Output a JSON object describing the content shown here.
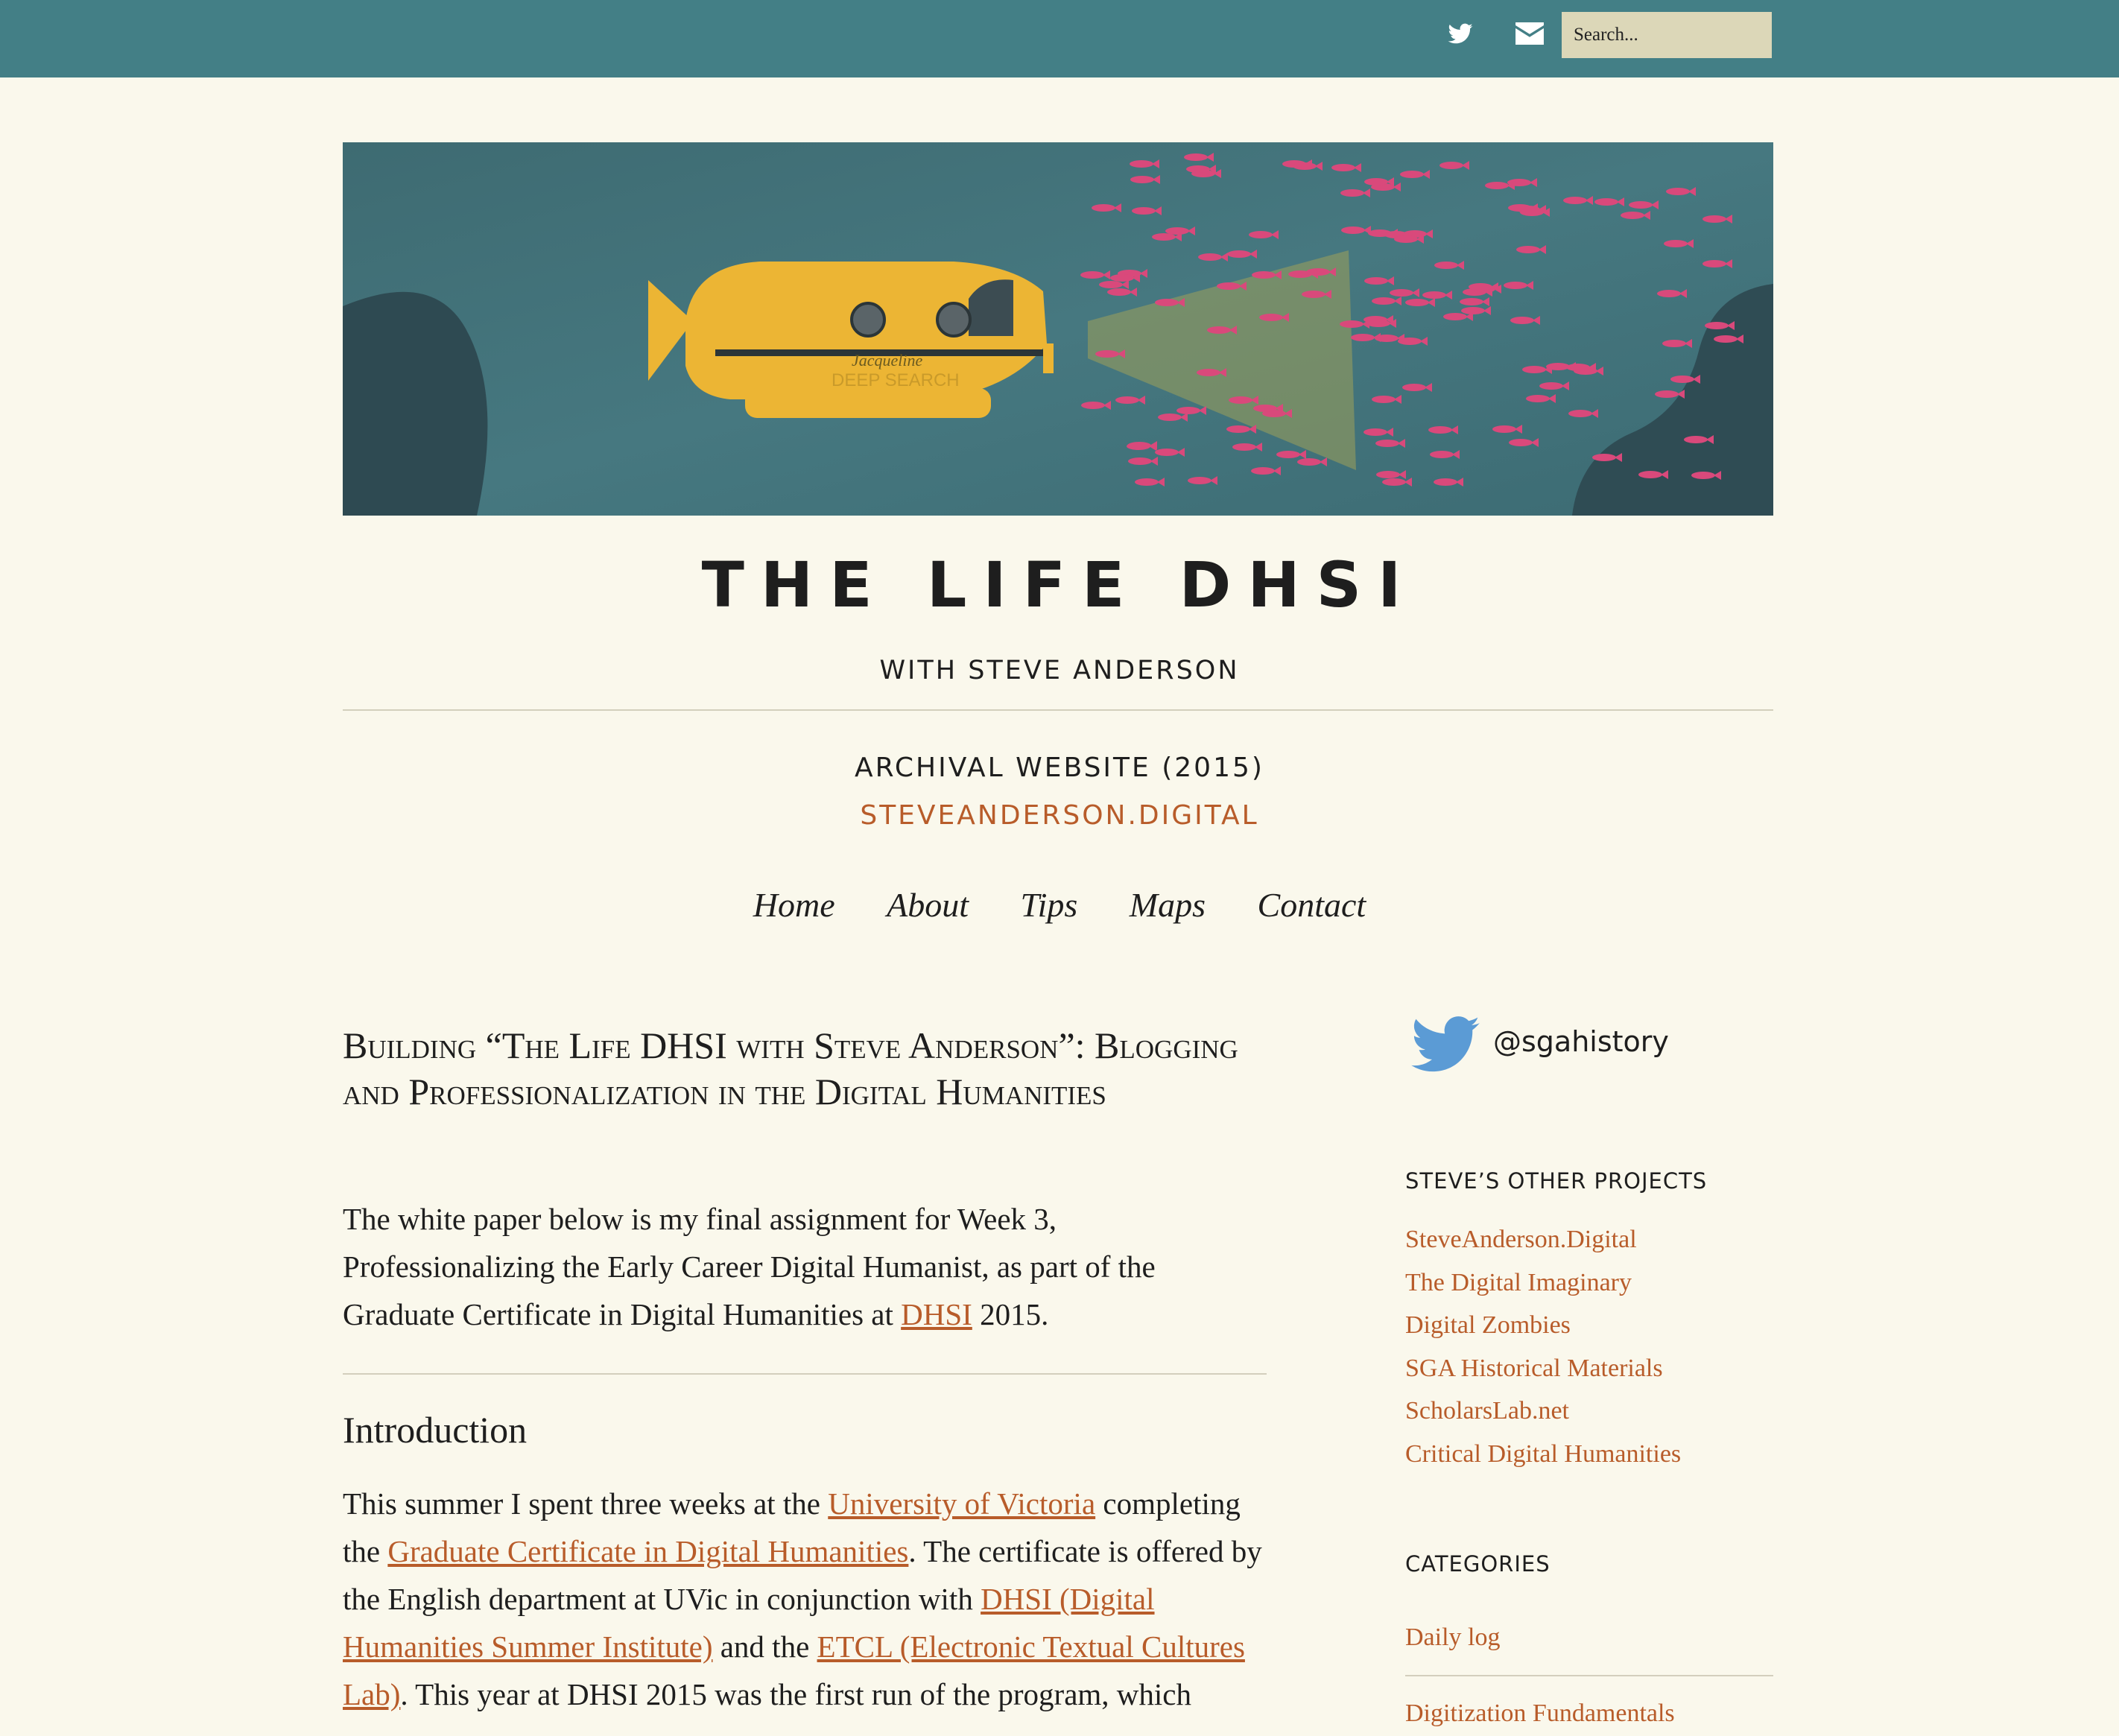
{
  "header": {
    "search_placeholder": "Search...",
    "icons": [
      "twitter-icon",
      "envelope-icon"
    ]
  },
  "banner": {
    "sub_name": "Jacqueline",
    "sub_label": "DEEP SEARCH"
  },
  "site": {
    "title": "THE LIFE DHSI",
    "subtitle": "WITH STEVE ANDERSON",
    "archival": "ARCHIVAL WEBSITE (2015)",
    "archival_link": "STEVEANDERSON.DIGITAL"
  },
  "nav": [
    "Home",
    "About",
    "Tips",
    "Maps",
    "Contact"
  ],
  "post": {
    "title": "Building “The Life DHSI with Steve Anderson”: Blogging and Professionalization in the Digital Humanities",
    "intro_before": "The white paper below is my final assignment for Week 3, Professionalizing the Early Career Digital Humanist, as part of the Graduate Certificate in Digital Humanities at ",
    "intro_link": "DHSI",
    "intro_after": " 2015.",
    "heading": "Introduction",
    "p_t1": "This summer I spent three weeks at the ",
    "p_l1": "University of Victoria",
    "p_t2": " completing the ",
    "p_l2": "Graduate Certificate in Digital Humanities",
    "p_t3": ". The certificate is offered by the English department at UVic in conjunction with ",
    "p_l3": "DHSI (Digital Humanities Summer Institute)",
    "p_t4": " and the ",
    "p_l4": "ETCL (Electronic Textual Cultures Lab)",
    "p_t5": ". This year at DHSI 2015 was the first run of the program, which"
  },
  "sidebar": {
    "twitter_handle": "@sgahistory",
    "projects_heading": "STEVE’S OTHER PROJECTS",
    "projects": [
      "SteveAnderson.Digital",
      "The Digital Imaginary",
      "Digital Zombies",
      "SGA Historical Materials",
      "ScholarsLab.net",
      "Critical Digital Humanities"
    ],
    "categories_heading": "CATEGORIES",
    "categories": [
      "Daily log",
      "Digitization Fundamentals"
    ]
  },
  "colors": {
    "topbar": "#437f86",
    "background": "#faf8ec",
    "link": "#b85c2a",
    "text": "#1e1e1e",
    "search_bg": "#dcd7b8"
  }
}
